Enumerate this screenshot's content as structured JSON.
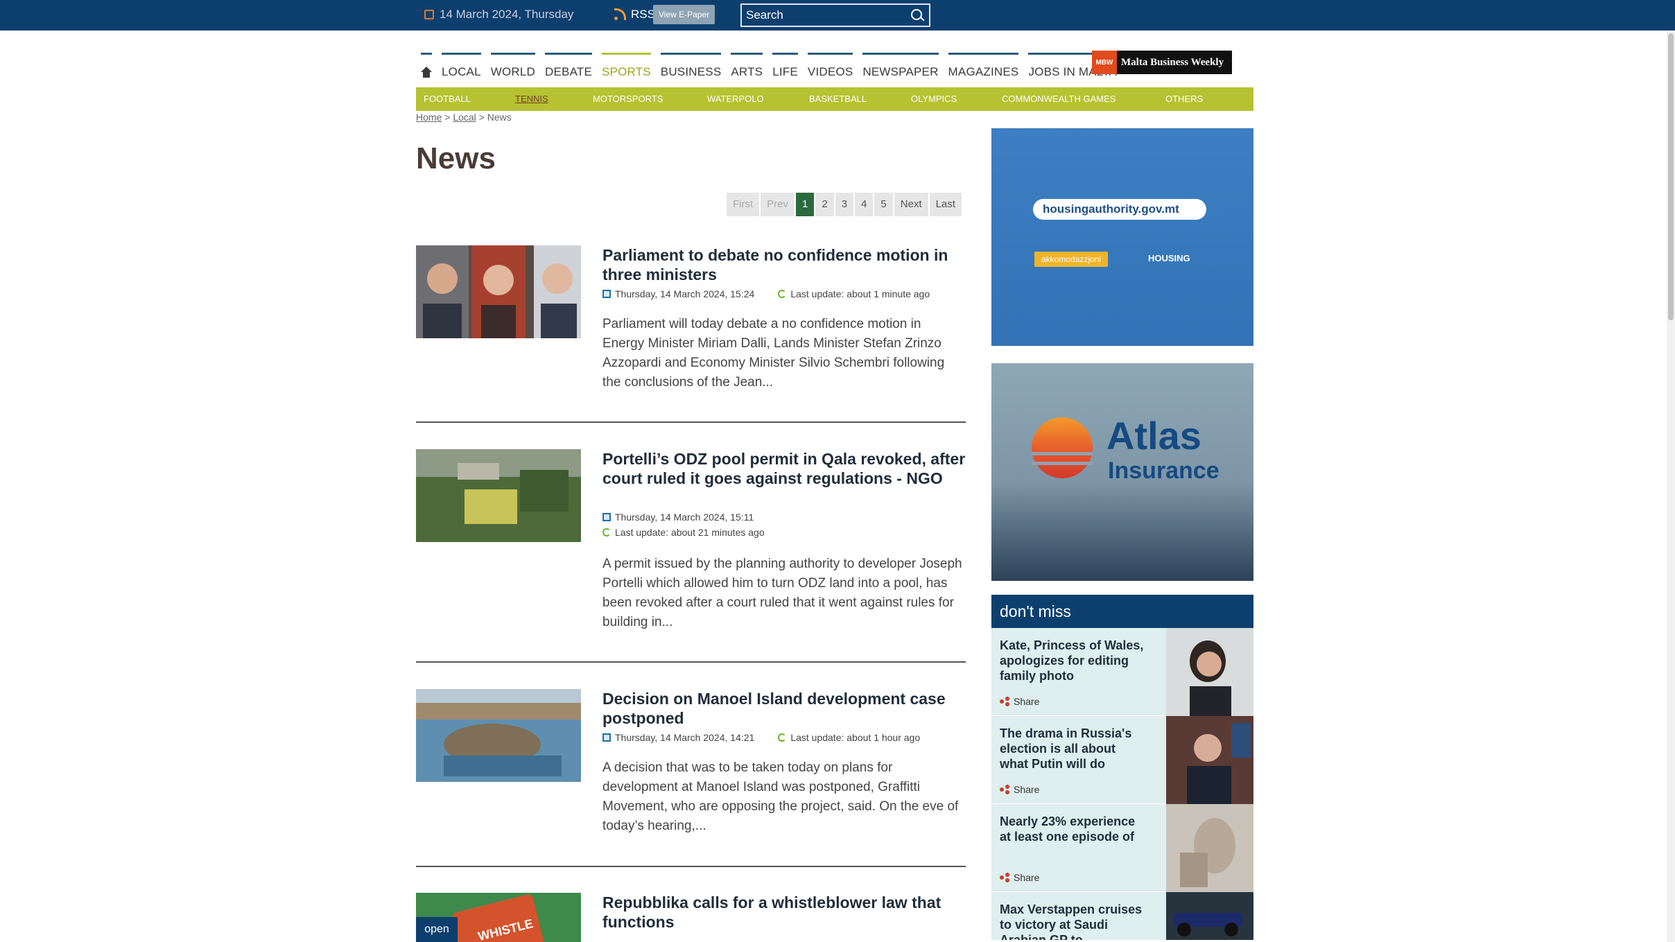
{
  "topbar": {
    "date": "14 March 2024, Thursday",
    "rss_label": "RSS",
    "epaper_label": "View E-Paper",
    "search_placeholder": "Search"
  },
  "nav": {
    "items": [
      "LOCAL",
      "WORLD",
      "DEBATE",
      "SPORTS",
      "BUSINESS",
      "ARTS",
      "LIFE",
      "VIDEOS",
      "NEWSPAPER",
      "MAGAZINES",
      "JOBS IN MALTA"
    ],
    "mbw_logo": "MBW",
    "mbw_label": "Malta Business Weekly"
  },
  "subnav": {
    "items": [
      "FOOTBALL",
      "TENNIS",
      "MOTORSPORTS",
      "WATERPOLO",
      "BASKETBALL",
      "OLYMPICS",
      "COMMONWEALTH GAMES",
      "OTHERS"
    ],
    "active": "TENNIS"
  },
  "breadcrumb": {
    "home": "Home",
    "sep": ">",
    "local": "Local",
    "current": "News"
  },
  "page_title": "News",
  "pagination": [
    "First",
    "Prev",
    "1",
    "2",
    "3",
    "4",
    "5",
    "Next",
    "Last"
  ],
  "articles": [
    {
      "title": "Parliament to debate no confidence motion in three ministers",
      "date": "Thursday, 14 March 2024, 15:24",
      "updated": "Last update: about 1 minute ago",
      "excerpt": "Parliament will today debate a no confidence motion in Energy Minister Miriam Dalli, Lands Minister Stefan Zrinzo Azzopardi and Economy Minister Silvio Schembri following the conclusions of the Jean..."
    },
    {
      "title": "Portelli’s ODZ pool permit in Qala revoked, after court ruled it goes against regulations - NGO",
      "date": "Thursday, 14 March 2024, 15:11",
      "updated": "Last update: about 21 minutes ago",
      "excerpt": "A permit issued by the planning authority to developer Joseph Portelli which allowed him to turn ODZ land into a pool, has been revoked after a court ruled that it went against rules for building in..."
    },
    {
      "title": "Decision on Manoel Island development case postponed",
      "date": "Thursday, 14 March 2024, 14:21",
      "updated": "Last update: about 1 hour ago",
      "excerpt": "A decision that was to be taken today on plans for development at Manoel Island was postponed, Graffitti Movement, who are opposing the project, said. On the eve of today’s hearing,..."
    },
    {
      "title": "Repubblika calls for a whistleblower law that functions",
      "open_label": "open",
      "thumb_text": "WHISTLE"
    }
  ],
  "ads": {
    "housing_url": "housingauthority.gov.mt",
    "housing_tag": "akkomodazzjoni",
    "housing_logo": "HOUSING",
    "atlas_title": "Atlas",
    "atlas_sub": "Insurance"
  },
  "dont_miss": {
    "heading": "don't miss",
    "share_label": "Share",
    "items": [
      {
        "title": "Kate, Princess of Wales, apologizes for editing family photo"
      },
      {
        "title": "The drama in Russia's election is all about what Putin will do"
      },
      {
        "title": "Nearly 23% experience at least one episode of"
      },
      {
        "title": "Max Verstappen cruises to victory at Saudi Arabian GP to"
      }
    ]
  },
  "colors": {
    "topbar": "#0d3f6e",
    "sports_accent": "#b6c232",
    "pager_current": "#2b6a3c"
  }
}
